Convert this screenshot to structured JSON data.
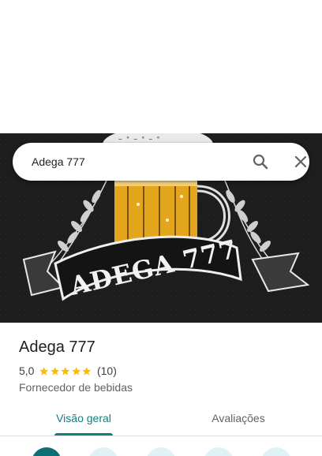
{
  "search": {
    "query": "Adega 777",
    "search_icon": "search-icon",
    "close_icon": "close-icon"
  },
  "hero": {
    "sign_text": "ADEGA 777",
    "colors": {
      "background": "#1c1c1c",
      "beer": "#e3a51b",
      "banner": "#1a1a1a"
    }
  },
  "place": {
    "name": "Adega 777",
    "rating_value": "5,0",
    "stars": 5,
    "review_count": "(10)",
    "category": "Fornecedor de bebidas"
  },
  "tabs": [
    {
      "label": "Visão geral",
      "active": true
    },
    {
      "label": "Avaliações",
      "active": false
    }
  ],
  "actions": [
    {
      "icon": "directions-icon"
    },
    {
      "icon": "save-icon"
    },
    {
      "icon": "nearby-icon"
    },
    {
      "icon": "send-to-phone-icon"
    },
    {
      "icon": "share-icon"
    }
  ],
  "colors": {
    "accent": "#0f7f7f",
    "star": "#fbbc04",
    "text": "#202124",
    "secondary": "#5f6368"
  }
}
